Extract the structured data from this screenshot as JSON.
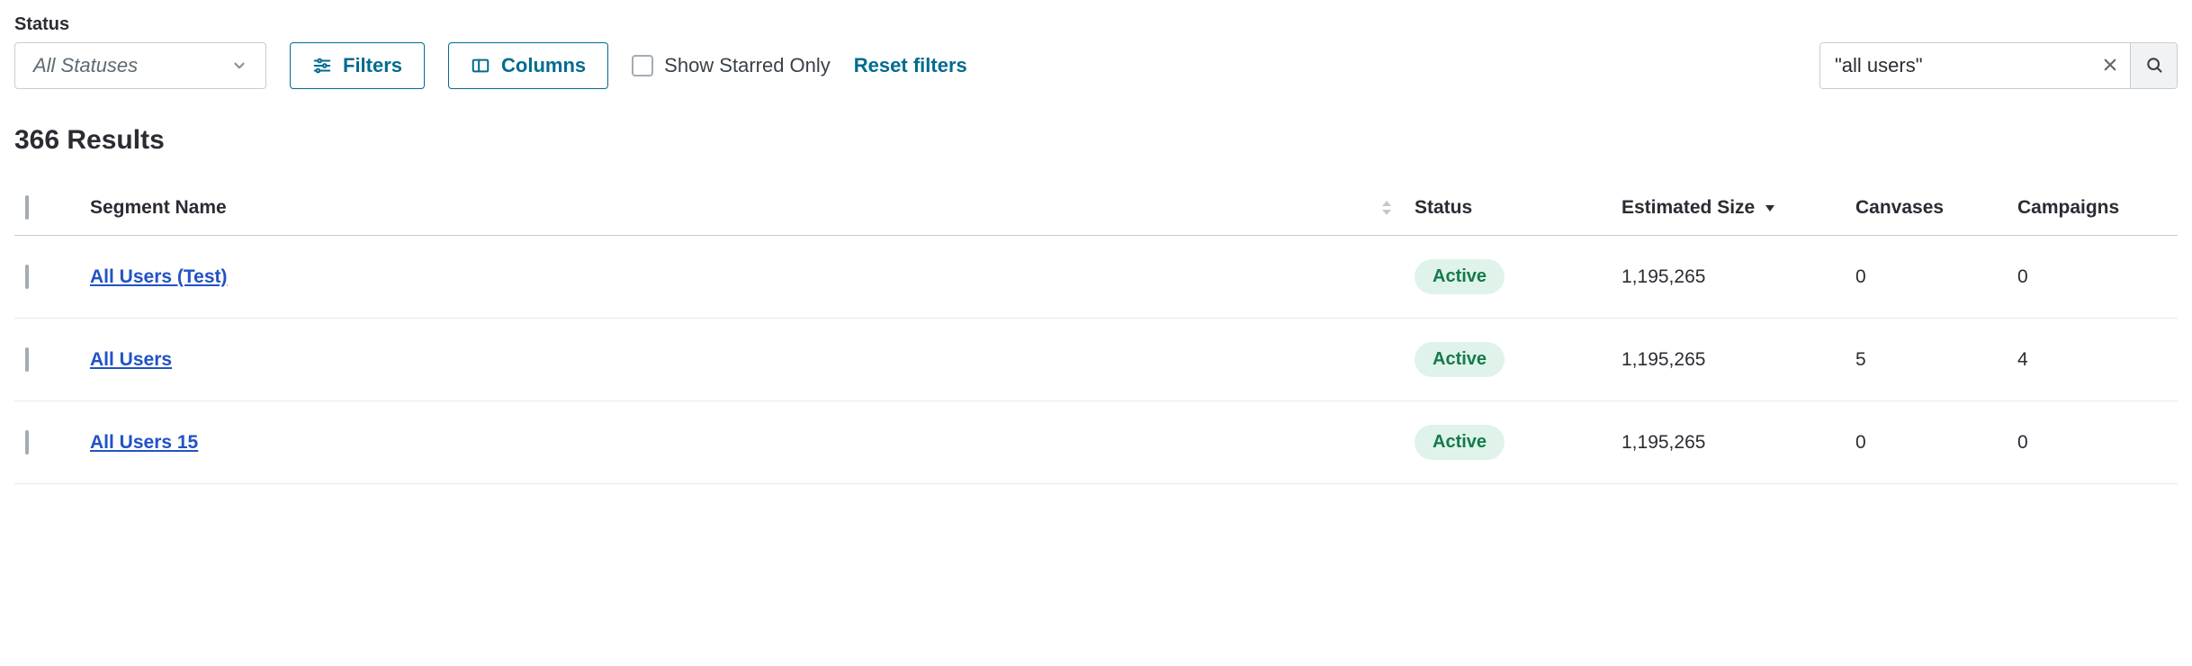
{
  "filters": {
    "status_label": "Status",
    "status_selected": "All Statuses",
    "filters_btn": "Filters",
    "columns_btn": "Columns",
    "show_starred_label": "Show Starred Only",
    "reset_label": "Reset filters",
    "search_value": "\"all users\""
  },
  "results_count": "366 Results",
  "columns": {
    "name": "Segment Name",
    "status": "Status",
    "size": "Estimated Size",
    "canvases": "Canvases",
    "campaigns": "Campaigns"
  },
  "rows": [
    {
      "name": "All Users (Test)",
      "status": "Active",
      "size": "1,195,265",
      "canvases": "0",
      "campaigns": "0"
    },
    {
      "name": "All Users",
      "status": "Active",
      "size": "1,195,265",
      "canvases": "5",
      "campaigns": "4"
    },
    {
      "name": "All Users 15",
      "status": "Active",
      "size": "1,195,265",
      "canvases": "0",
      "campaigns": "0"
    }
  ]
}
